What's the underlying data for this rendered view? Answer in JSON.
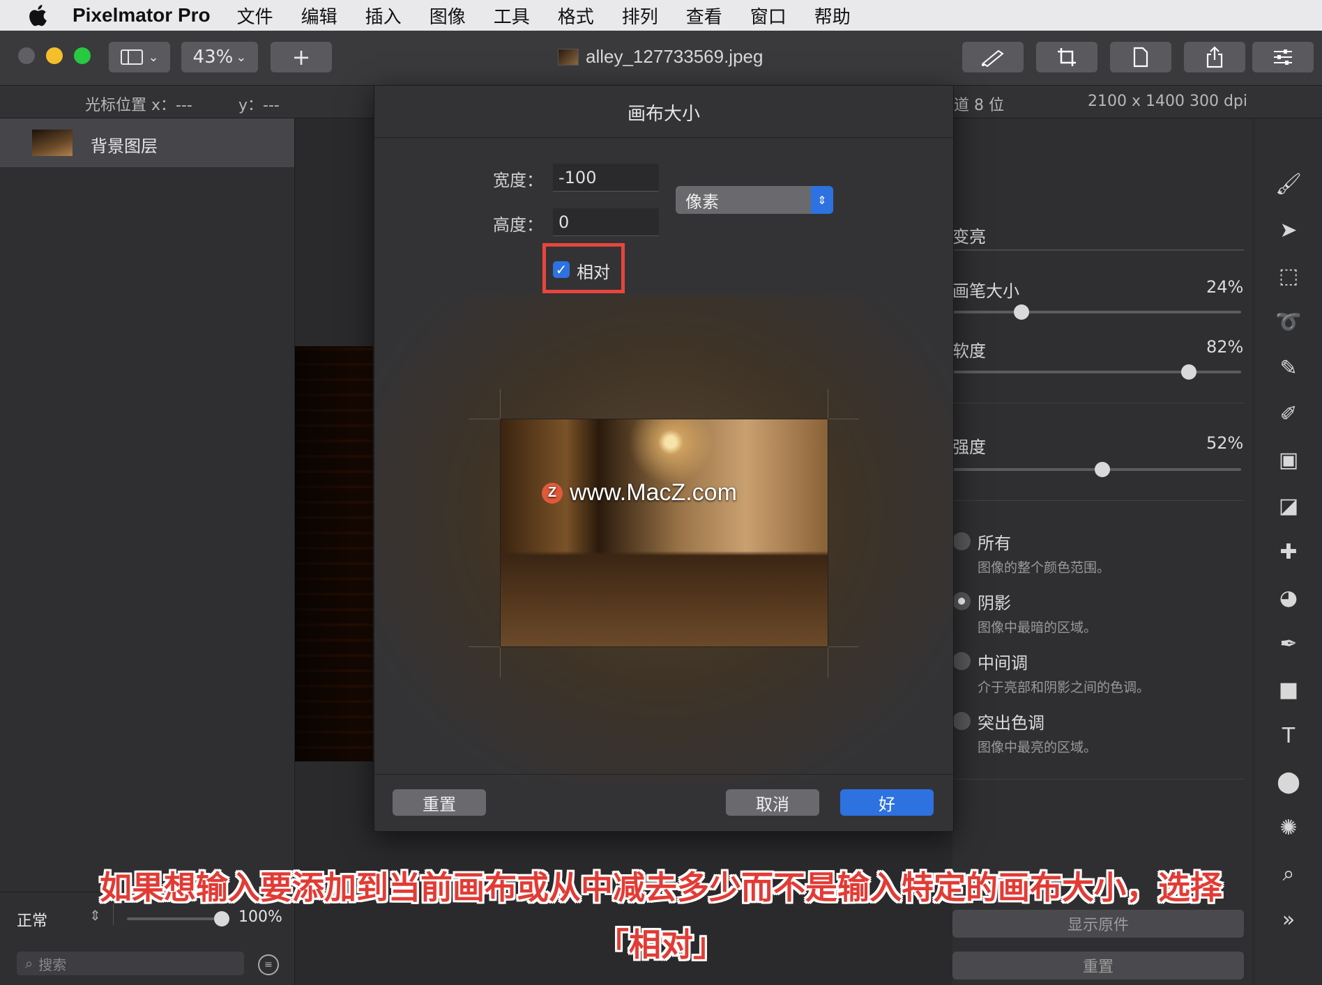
{
  "menubar": {
    "app_name": "Pixelmator Pro",
    "items": [
      "文件",
      "编辑",
      "插入",
      "图像",
      "工具",
      "格式",
      "排列",
      "查看",
      "窗口",
      "帮助"
    ]
  },
  "toolbar": {
    "zoom": "43%",
    "add_label": "+",
    "document_title": "alley_127733569.jpeg"
  },
  "infobar": {
    "cursor_x_label": "光标位置 x：---",
    "cursor_y_label": "y：---",
    "channel_label": "道 8 位",
    "dimensions": "2100 x 1400 300 dpi"
  },
  "layers": {
    "items": [
      {
        "name": "背景图层"
      }
    ],
    "blend_mode": "正常",
    "opacity": "100%",
    "opacity_value": 1.0,
    "search_placeholder": "搜索"
  },
  "tool_options": {
    "tool_name": "变亮",
    "brush_size_label": "画笔大小",
    "brush_size_value": "24%",
    "brush_size_fraction": 0.24,
    "softness_label": "软度",
    "softness_value": "82%",
    "softness_fraction": 0.82,
    "strength_label": "强度",
    "strength_value": "52%",
    "strength_fraction": 0.52,
    "range_options": [
      {
        "label": "所有",
        "desc": "图像的整个颜色范围。",
        "selected": false
      },
      {
        "label": "阴影",
        "desc": "图像中最暗的区域。",
        "selected": true
      },
      {
        "label": "中间调",
        "desc": "介于亮部和阴影之间的色调。",
        "selected": false
      },
      {
        "label": "突出色调",
        "desc": "图像中最亮的区域。",
        "selected": false
      }
    ],
    "show_original_label": "显示原件",
    "reset_label": "重置"
  },
  "dialog": {
    "title": "画布大小",
    "width_label": "宽度：",
    "width_value": "-100",
    "height_label": "高度：",
    "height_value": "0",
    "unit": "像素",
    "relative_label": "相对",
    "relative_checked": true,
    "reset_label": "重置",
    "cancel_label": "取消",
    "ok_label": "好"
  },
  "watermark": {
    "logo": "Z",
    "text": "www.MacZ.com"
  },
  "caption": {
    "line1": "如果想输入要添加到当前画布或从中减去多少而不是输入特定的画布大小，选择",
    "line2": "「相对」"
  },
  "colors": {
    "accent": "#2d72e0",
    "highlight": "#e8453c",
    "caption": "#e23b35"
  }
}
